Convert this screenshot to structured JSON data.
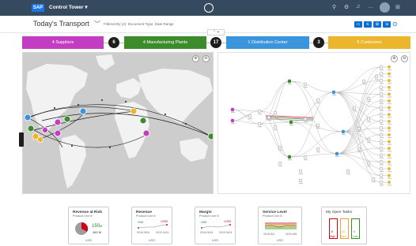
{
  "shell": {
    "logo": "SAP",
    "app_title": "Control Tower ▾",
    "right_icons": [
      "search-icon",
      "settings-icon",
      "bell-icon",
      "more-icon",
      "avatar",
      "grid-icon"
    ]
  },
  "header": {
    "title": "Today's Transport",
    "caret": "﹀",
    "filter_text": "Filtered By (2): Document Type, Date Range",
    "collapse_label": "⌃ ⌖"
  },
  "stages": [
    {
      "label": "4 Suppliers",
      "color": "#c23dc2"
    },
    {
      "label": "4 Manufacturing Plants",
      "color": "#3c8c2b"
    },
    {
      "label": "1 Distribution Center",
      "color": "#3a95dc"
    },
    {
      "label": "5 Customers",
      "color": "#ebb52c"
    }
  ],
  "connectors": [
    "6",
    "17",
    "3"
  ],
  "map": {
    "zoom_in": "⊕",
    "zoom_out": "⊖"
  },
  "network": {
    "zoom_in": "⊕",
    "zoom_out": "⊖"
  },
  "kpis": [
    {
      "title": "Revenue at Risk",
      "subtitle": "Product Line A",
      "value": "150",
      "value_suffix": "M",
      "secondary": "380 M",
      "unit": "USD"
    },
    {
      "title": "Revenue",
      "subtitle": "Product Line A",
      "left_value": "20M",
      "right_value": "120M",
      "left_period": "2018 W24",
      "right_period": "2019 W24",
      "unit": "USD"
    },
    {
      "title": "Margin",
      "subtitle": "Product Line A",
      "left_value": "20M",
      "right_value": "120M",
      "left_period": "2018 W24",
      "right_period": "2019 W24",
      "unit": "USD"
    },
    {
      "title": "Service Level",
      "subtitle": "Product Line A",
      "left_period": "2018 W1",
      "right_period": "2019 W6",
      "unit": "USD"
    },
    {
      "title": "My Open Tasks",
      "counts": [
        "8",
        "10",
        "4"
      ],
      "labels": [
        "High",
        "Med",
        "Low"
      ]
    }
  ],
  "colors": {
    "shell": "#354a5f",
    "accent": "#0a6ed1",
    "supplier": "#c23dc2",
    "plant": "#3c8c2b",
    "dc": "#3a95dc",
    "customer": "#ebb52c",
    "danger": "#d0021b"
  }
}
